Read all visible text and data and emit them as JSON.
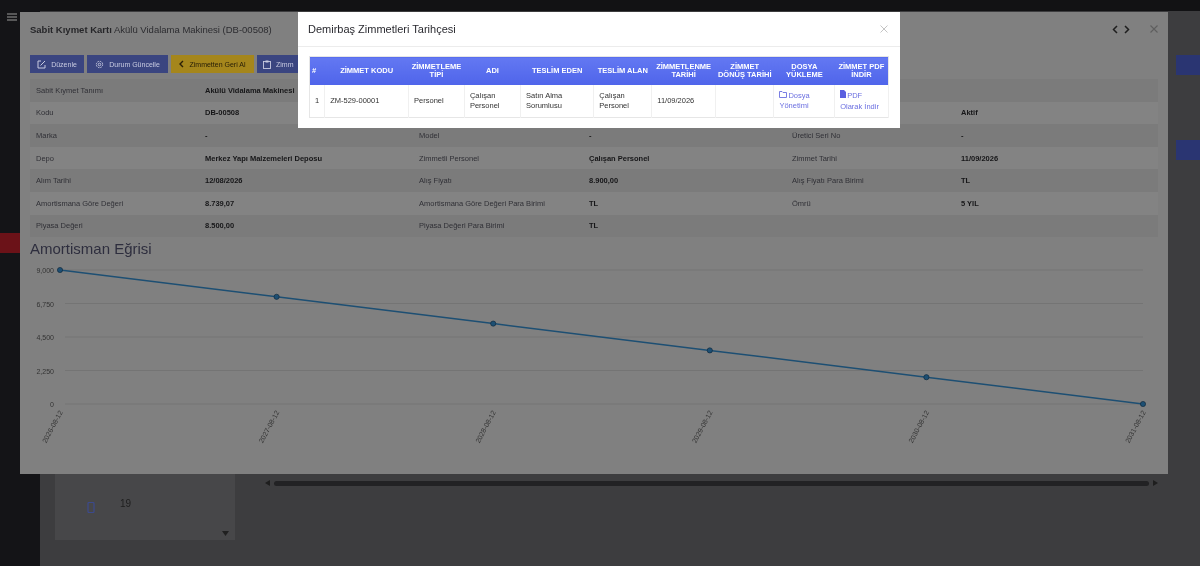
{
  "background_app": {
    "stat_card": {
      "count": "19"
    }
  },
  "asset_modal": {
    "title": "**Sabit Kıymet Kartı** Akülü Vidalama Makinesi (DB-00508)",
    "buttons": [
      {
        "label": "Düzenle",
        "kind": "primary"
      },
      {
        "label": "Durum Güncelle",
        "kind": "primary"
      },
      {
        "label": "Zimmetten Geri Al",
        "kind": "warning"
      },
      {
        "label": "Zimm",
        "kind": "primary"
      }
    ],
    "details": [
      {
        "left": {
          "label": "Sabit Kıymet Tanımı",
          "value": "Akülü Vidalama Makinesi"
        }
      },
      {
        "left": {
          "label": "Kodu",
          "value": "DB-00508"
        },
        "right": {
          "value": "Aktif"
        }
      },
      {
        "left": {
          "label": "Marka",
          "value": "-"
        },
        "middle": {
          "label": "Model",
          "value": "-"
        },
        "right": {
          "label": "Üretici Seri No",
          "value": "-"
        }
      },
      {
        "left": {
          "label": "Depo",
          "value": "Merkez Yapı Malzemeleri Deposu"
        },
        "middle": {
          "label": "Zimmetli Personel",
          "value": "Çalışan Personel"
        },
        "right": {
          "label": "Zimmet Tarihi",
          "value": "11/09/2026"
        }
      },
      {
        "left": {
          "label": "Alım Tarihi",
          "value": "12/08/2026"
        },
        "middle": {
          "label": "Alış Fiyatı",
          "value": "8.900,00"
        },
        "right": {
          "label": "Alış Fiyatı Para Birimi",
          "value": "TL"
        }
      },
      {
        "left": {
          "label": "Amortismana Göre Değeri",
          "value": "8.739,07"
        },
        "middle": {
          "label": "Amortismana Göre Değeri Para Birimi",
          "value": "TL"
        },
        "right": {
          "label": "Ömrü",
          "value": "5 YIL"
        }
      },
      {
        "left": {
          "label": "Piyasa Değeri",
          "value": "8.500,00"
        },
        "middle": {
          "label": "Piyasa Değeri Para Birimi",
          "value": "TL"
        }
      }
    ],
    "chart": {
      "chart_data": {
        "type": "line",
        "title": "Amortisman Eğrisi",
        "categories": [
          "2026-08-12",
          "2027-08-12",
          "2028-08-12",
          "2029-08-12",
          "2030-08-12",
          "2031-08-12"
        ],
        "series": [
          {
            "color": "#1d4f73",
            "marker": "circle",
            "values": [
              9000,
              7200,
              5400,
              3600,
              1800,
              0
            ]
          }
        ],
        "grid": true,
        "ylim": [
          0,
          9000
        ],
        "yticks": [
          {
            "value": 0,
            "label": "0"
          },
          {
            "value": 2250,
            "label": "2,250"
          },
          {
            "value": 4500,
            "label": "4,500"
          },
          {
            "value": 6750,
            "label": "6,750"
          },
          {
            "value": 9000,
            "label": "9,000"
          }
        ]
      }
    }
  },
  "history_modal": {
    "title": "Demirbaş Zimmetleri Tarihçesi",
    "columns": [
      "#",
      "ZİMMET KODU",
      "ZİMMETLEME TİPİ",
      "ADI",
      "TESLİM EDEN",
      "TESLİM ALAN",
      "ZİMMETLENME TARİHİ",
      "ZİMMET DÖNÜŞ TARİHİ",
      "DOSYA YÜKLEME",
      "ZİMMET PDF İNDİR"
    ],
    "rows": [
      {
        "cells": [
          "1",
          "ZM-529-00001",
          "Personel",
          "Çalışan Personel",
          "Satın Alma Sorumlusu",
          "Çalışan Personel",
          "11/09/2026",
          ""
        ],
        "file_link": "Dosya Yönetimi",
        "pdf_link": "PDF Olarak İndir"
      }
    ]
  }
}
